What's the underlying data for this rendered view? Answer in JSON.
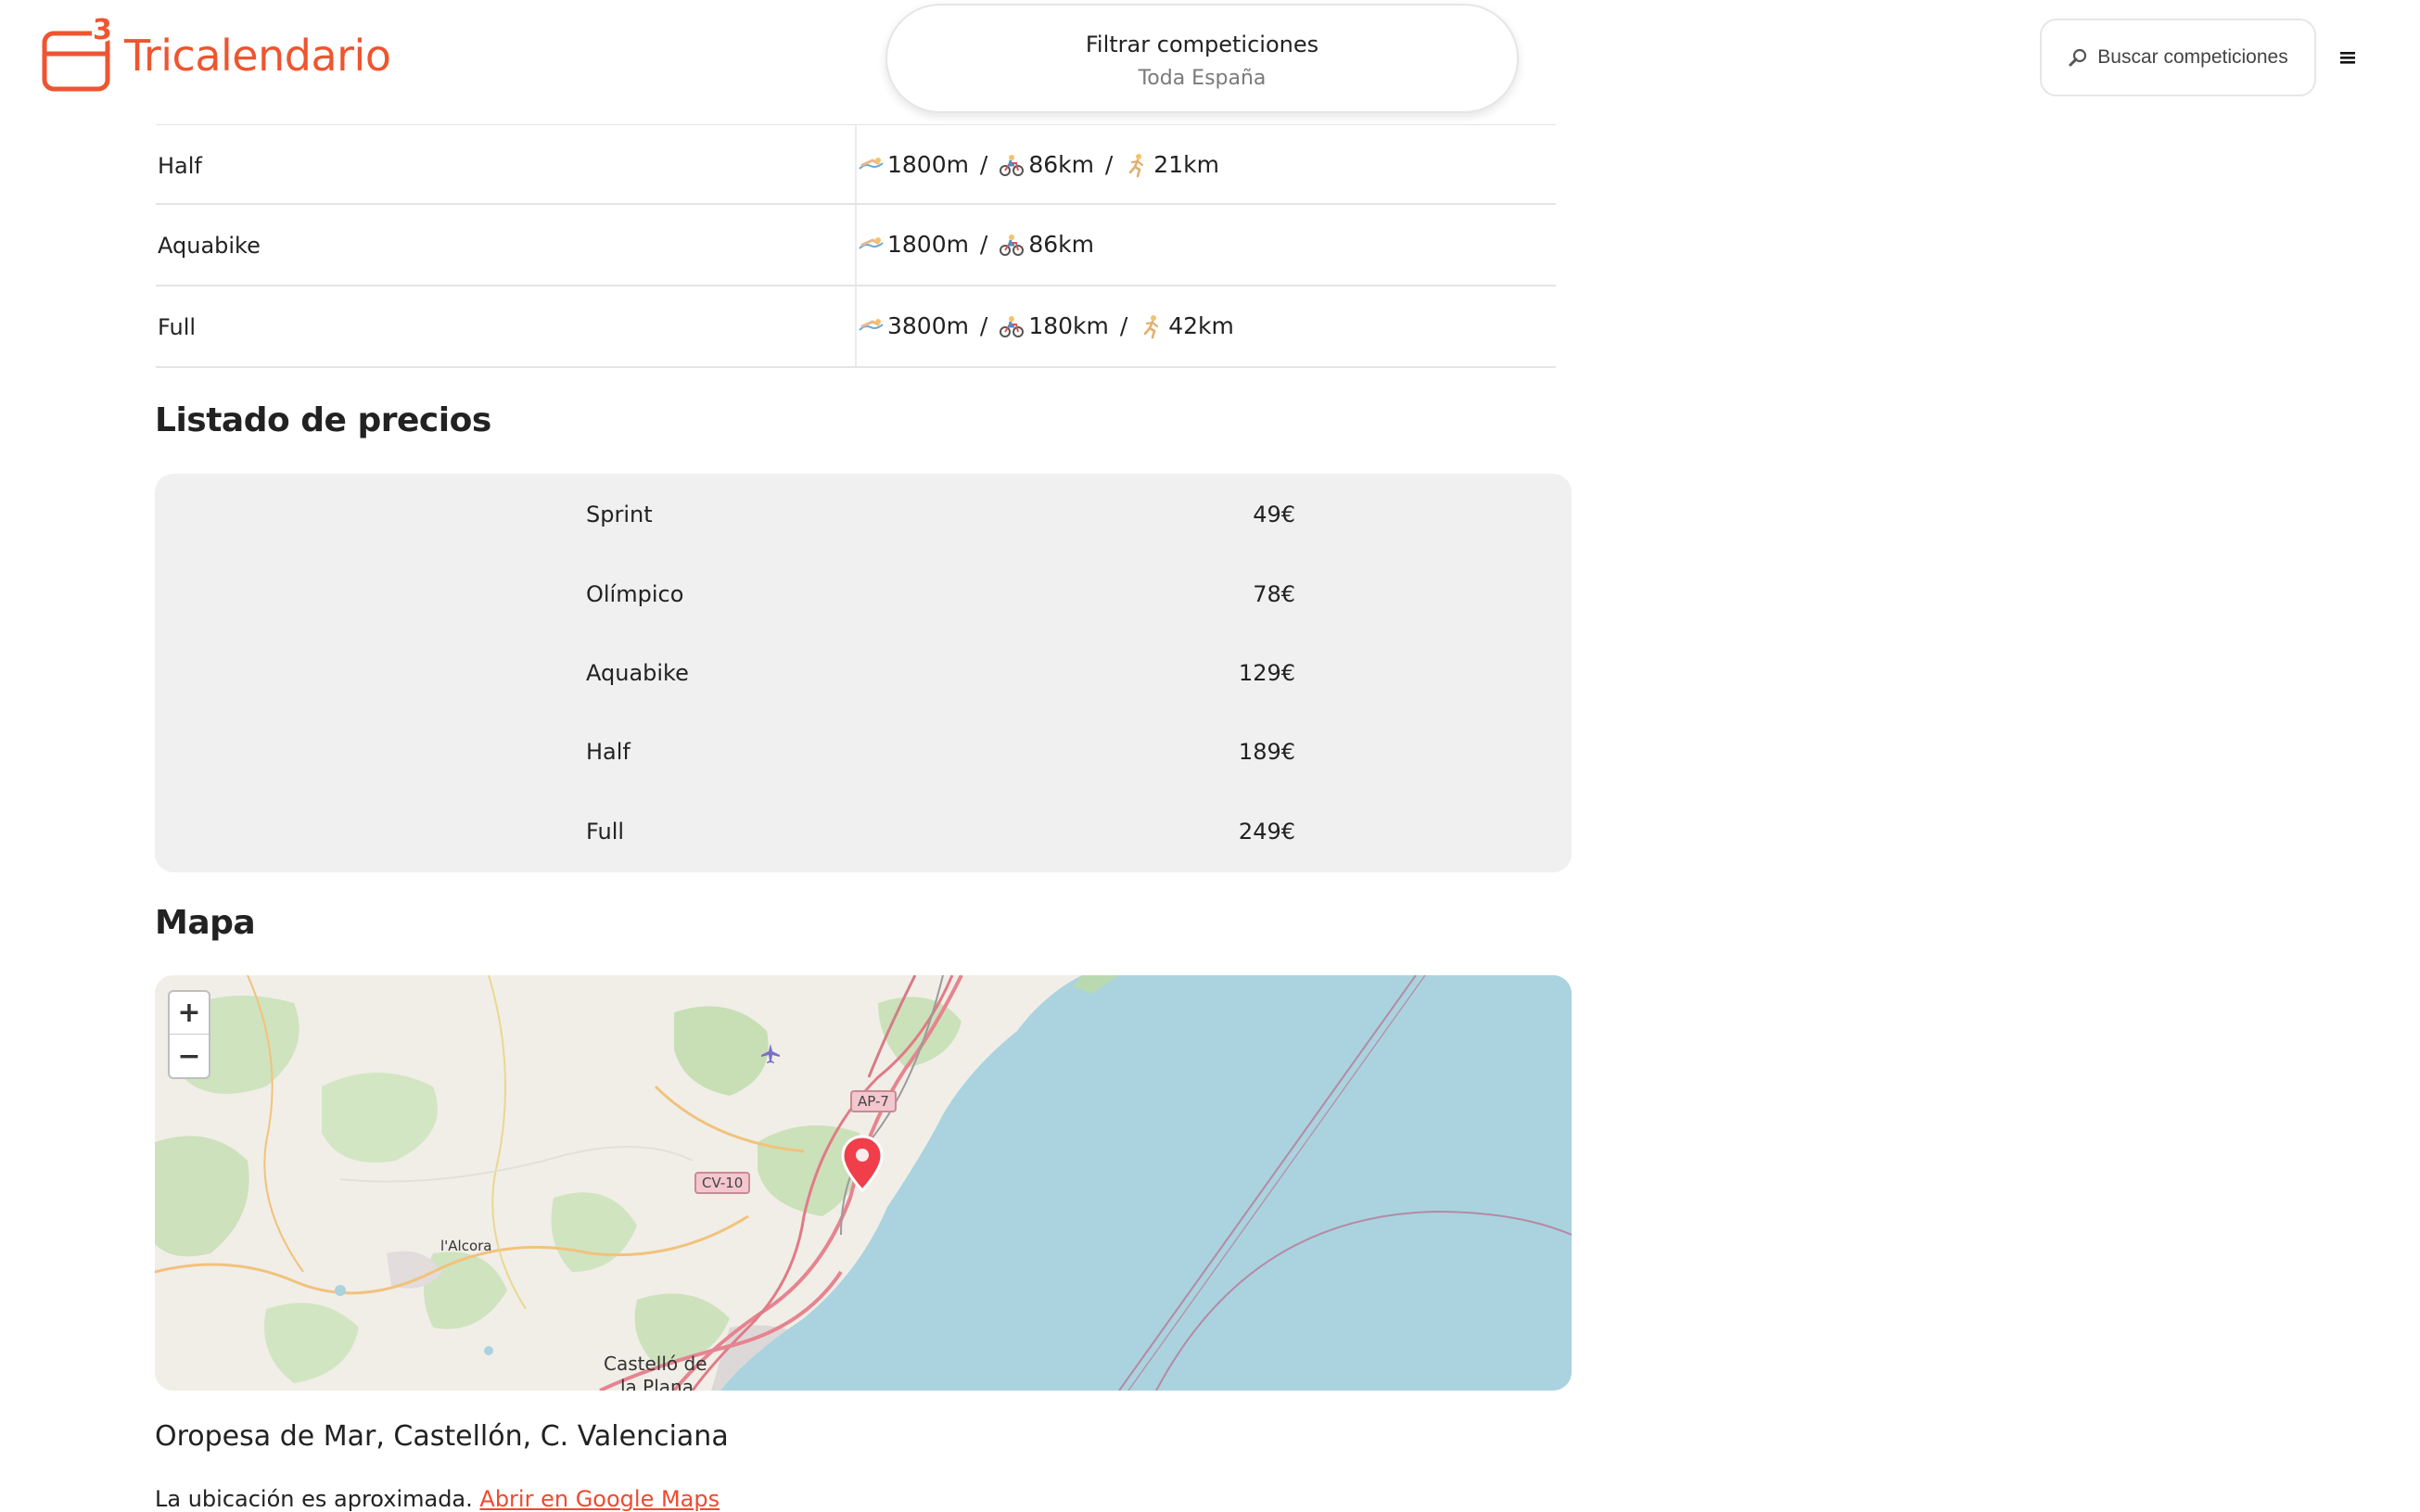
{
  "header": {
    "logo_text": "Tricalendario",
    "filter": {
      "title": "Filtrar competiciones",
      "subtitle": "Toda España"
    },
    "search_label": "Buscar competiciones",
    "brand_color": "#ee5530"
  },
  "distances": [
    {
      "name": "Half",
      "swim": "1800m",
      "bike": "86km",
      "run": "21km"
    },
    {
      "name": "Aquabike",
      "swim": "1800m",
      "bike": "86km",
      "run": null
    },
    {
      "name": "Full",
      "swim": "3800m",
      "bike": "180km",
      "run": "42km"
    }
  ],
  "prices": {
    "title": "Listado de precios",
    "rows": [
      {
        "name": "Sprint",
        "price": "49€"
      },
      {
        "name": "Olímpico",
        "price": "78€"
      },
      {
        "name": "Aquabike",
        "price": "129€"
      },
      {
        "name": "Half",
        "price": "189€"
      },
      {
        "name": "Full",
        "price": "249€"
      }
    ]
  },
  "map": {
    "title": "Mapa",
    "zoom_in": "+",
    "zoom_out": "−",
    "labels": {
      "alcora": "l'Alcora",
      "castello_1": "Castelló de",
      "castello_2": "la Plana"
    },
    "roads": {
      "ap7": "AP-7",
      "cv10": "CV-10"
    },
    "marker_color": "#f03e4a",
    "sea_color": "#aad3df"
  },
  "location": {
    "address": "Oropesa de Mar, Castellón, C. Valenciana",
    "approx_text": "La ubicación es aproximada.",
    "gmaps_link": "Abrir en Google Maps"
  }
}
